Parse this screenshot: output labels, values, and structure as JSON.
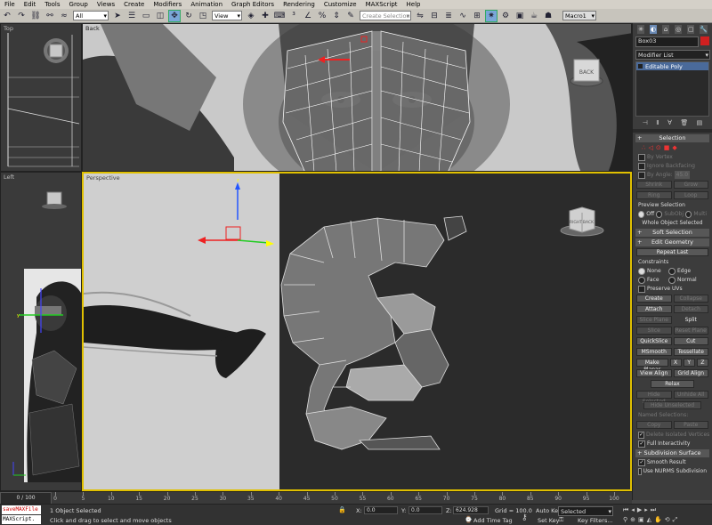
{
  "menu": [
    "File",
    "Edit",
    "Tools",
    "Group",
    "Views",
    "Create",
    "Modifiers",
    "Animation",
    "Graph Editors",
    "Rendering",
    "Customize",
    "MAXScript",
    "Help"
  ],
  "toolbar": {
    "filter_value": "All",
    "coord_value": "View",
    "selection_set_placeholder": "Create Selection Se",
    "macro_label": "Macro1",
    "icons": [
      "undo-icon",
      "redo-icon",
      "link-icon",
      "unlink-icon",
      "bind-icon",
      "select-icon",
      "select-by-name-icon",
      "region-icon",
      "window-crossing-icon",
      "move-icon",
      "rotate-icon",
      "scale-icon",
      "pivot-icon",
      "select-manipulate-icon",
      "keyboard-shortcut-icon",
      "snap-icon",
      "angle-snap-icon",
      "percent-snap-icon",
      "spinner-snap-icon",
      "mirror-icon",
      "align-icon",
      "layer-icon",
      "curve-editor-icon",
      "schematic-icon",
      "material-editor-icon",
      "render-setup-icon",
      "render-frame-icon",
      "render-icon"
    ]
  },
  "viewports": {
    "top": {
      "label": "Top"
    },
    "back": {
      "label": "Back"
    },
    "left": {
      "label": "Left"
    },
    "perspective": {
      "label": "Perspective"
    },
    "viewcube_back": "BACK",
    "viewcube_persp_left": "RIGHT",
    "viewcube_persp_right": "BACK"
  },
  "command_panel": {
    "object_name": "Box03",
    "modifier_list": "Modifier List",
    "stack_item": "Editable Poly",
    "selection": {
      "title": "Selection",
      "by_vertex": "By Vertex",
      "ignore_backfacing": "Ignore Backfacing",
      "by_angle": "By Angle:",
      "angle_value": "45.0",
      "shrink": "Shrink",
      "grow": "Grow",
      "ring": "Ring",
      "loop": "Loop",
      "preview_title": "Preview Selection",
      "preview_off": "Off",
      "preview_subobj": "SubObj",
      "preview_multi": "Multi",
      "status": "Whole Object Selected"
    },
    "soft_selection": {
      "title": "Soft Selection"
    },
    "edit_geometry": {
      "title": "Edit Geometry",
      "repeat_last": "Repeat Last",
      "constraints": "Constraints",
      "none": "None",
      "edge": "Edge",
      "face": "Face",
      "normal": "Normal",
      "preserve_uvs": "Preserve UVs",
      "create": "Create",
      "collapse": "Collapse",
      "attach": "Attach",
      "detach": "Detach",
      "slice_plane": "Slice Plane",
      "split": "Split",
      "slice": "Slice",
      "reset_plane": "Reset Plane",
      "quickslice": "QuickSlice",
      "cut": "Cut",
      "msmooth": "MSmooth",
      "tessellate": "Tessellate",
      "make_planar": "Make Planar",
      "x": "X",
      "y": "Y",
      "z": "Z",
      "view_align": "View Align",
      "grid_align": "Grid Align",
      "relax": "Relax",
      "hide_selected": "Hide Selected",
      "unhide_all": "Unhide All",
      "hide_unselected": "Hide Unselected",
      "named_selections": "Named Selections:",
      "copy": "Copy",
      "paste": "Paste",
      "delete_isolated": "Delete Isolated Vertices",
      "full_interactivity": "Full Interactivity"
    },
    "subdivision": {
      "title": "Subdivision Surface",
      "smooth_result": "Smooth Result",
      "use_nurms": "Use NURMS Subdivision"
    }
  },
  "timeline": {
    "frame_counter": "0 / 100",
    "ticks": [
      "0",
      "5",
      "10",
      "15",
      "20",
      "25",
      "30",
      "35",
      "40",
      "45",
      "50",
      "55",
      "60",
      "65",
      "70",
      "75",
      "80",
      "85",
      "90",
      "95",
      "100"
    ]
  },
  "status": {
    "script_top": "saveMAXFile",
    "script_bottom": "MAXScript.",
    "selected_count": "1 Object Selected",
    "prompt": "Click and drag to select and move objects",
    "x_label": "X:",
    "x_value": "0.0",
    "y_label": "Y:",
    "y_value": "0.0",
    "z_label": "Z:",
    "z_value": "624.928",
    "grid": "Grid = 100.0",
    "add_time_tag": "Add Time Tag",
    "auto_key": "Auto Key",
    "set_key": "Set Key",
    "key_mode_value": "Selected",
    "key_filters": "Key Filters..."
  }
}
